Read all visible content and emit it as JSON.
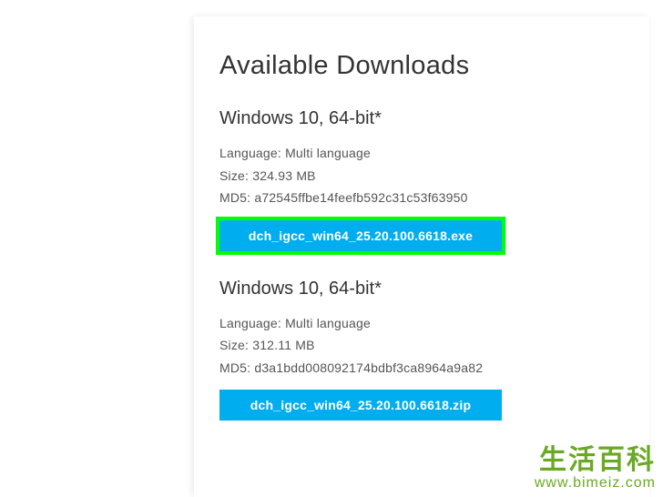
{
  "title": "Available Downloads",
  "downloads": [
    {
      "os": "Windows 10, 64-bit*",
      "language_label": "Language: Multi language",
      "size_label": "Size: 324.93 MB",
      "md5_label": "MD5: a72545ffbe14feefb592c31c53f63950",
      "filename": "dch_igcc_win64_25.20.100.6618.exe",
      "highlighted": true
    },
    {
      "os": "Windows 10, 64-bit*",
      "language_label": "Language: Multi language",
      "size_label": "Size: 312.11 MB",
      "md5_label": "MD5: d3a1bdd008092174bdbf3ca8964a9a82",
      "filename": "dch_igcc_win64_25.20.100.6618.zip",
      "highlighted": false
    }
  ],
  "watermark": {
    "chars": "生活百科",
    "url": "www.bimeiz.com"
  }
}
